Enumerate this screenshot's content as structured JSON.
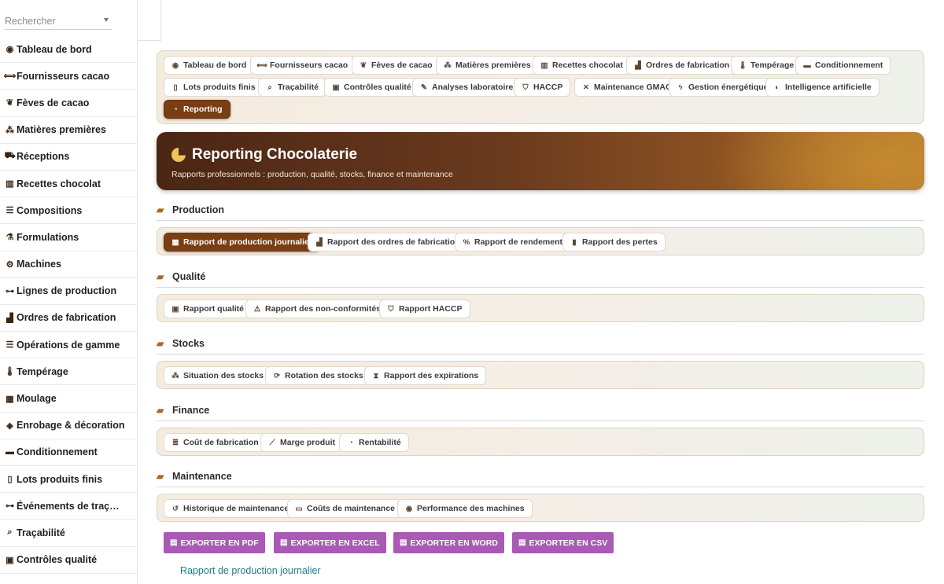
{
  "sidebar": {
    "search_placeholder": "Rechercher",
    "items": [
      {
        "label": "Tableau de bord",
        "icon": "gauge-icon",
        "glyph": "◉"
      },
      {
        "label": "Fournisseurs cacao",
        "icon": "handshake-icon",
        "glyph": "⟺"
      },
      {
        "label": "Fèves de cacao",
        "icon": "seedling-icon",
        "glyph": "❦"
      },
      {
        "label": "Matières premières",
        "icon": "cubes-icon",
        "glyph": "⁂"
      },
      {
        "label": "Réceptions",
        "icon": "truck-icon",
        "glyph": "⛟"
      },
      {
        "label": "Recettes chocolat",
        "icon": "book-icon",
        "glyph": "▥"
      },
      {
        "label": "Compositions",
        "icon": "list-icon",
        "glyph": "☰"
      },
      {
        "label": "Formulations",
        "icon": "flask-icon",
        "glyph": "⚗"
      },
      {
        "label": "Machines",
        "icon": "cogs-icon",
        "glyph": "⚙"
      },
      {
        "label": "Lignes de production",
        "icon": "sitemap-icon",
        "glyph": "⊶"
      },
      {
        "label": "Ordres de fabrication",
        "icon": "industry-icon",
        "glyph": "▟"
      },
      {
        "label": "Opérations de gamme",
        "icon": "list-ol-icon",
        "glyph": "☰"
      },
      {
        "label": "Tempérage",
        "icon": "thermometer-icon",
        "glyph": "🌡"
      },
      {
        "label": "Moulage",
        "icon": "grid-icon",
        "glyph": "▦"
      },
      {
        "label": "Enrobage & décoration",
        "icon": "fill-drip-icon",
        "glyph": "◈"
      },
      {
        "label": "Conditionnement",
        "icon": "box-icon",
        "glyph": "▬"
      },
      {
        "label": "Lots produits finis",
        "icon": "barcode-icon",
        "glyph": "▯"
      },
      {
        "label": "Événements de traç…",
        "icon": "project-diagram-icon",
        "glyph": "⊶"
      },
      {
        "label": "Traçabilité",
        "icon": "search-icon",
        "glyph": "⌕"
      },
      {
        "label": "Contrôles qualité",
        "icon": "clipboard-check-icon",
        "glyph": "▣"
      }
    ]
  },
  "nav": {
    "row1": [
      {
        "label": "Tableau de bord",
        "icon": "gauge-icon",
        "glyph": "◉"
      },
      {
        "label": "Fournisseurs cacao",
        "icon": "handshake-icon",
        "glyph": "⟺"
      },
      {
        "label": "Fèves de cacao",
        "icon": "seedling-icon",
        "glyph": "❦"
      },
      {
        "label": "Matières premières",
        "icon": "cubes-icon",
        "glyph": "⁂"
      },
      {
        "label": "Recettes chocolat",
        "icon": "book-icon",
        "glyph": "▥"
      },
      {
        "label": "Ordres de fabrication",
        "icon": "industry-icon",
        "glyph": "▟"
      },
      {
        "label": "Tempérage",
        "icon": "thermometer-icon",
        "glyph": "🌡"
      },
      {
        "label": "Conditionnement",
        "icon": "box-icon",
        "glyph": "▬"
      }
    ],
    "row2": [
      {
        "label": "Lots produits finis",
        "icon": "barcode-icon",
        "glyph": "▯"
      },
      {
        "label": "Traçabilité",
        "icon": "search-icon",
        "glyph": "⌕"
      },
      {
        "label": "Contrôles qualité",
        "icon": "clipboard-check-icon",
        "glyph": "▣"
      },
      {
        "label": "Analyses laboratoire",
        "icon": "pen-icon",
        "glyph": "✎"
      },
      {
        "label": "HACCP",
        "icon": "shield-icon",
        "glyph": "⛉"
      },
      {
        "label": "Maintenance GMAO",
        "icon": "tools-icon",
        "glyph": "✕"
      },
      {
        "label": "Gestion énergétique",
        "icon": "bolt-icon",
        "glyph": "ϟ"
      },
      {
        "label": "Intelligence artificielle",
        "icon": "brain-icon",
        "glyph": "◐"
      }
    ],
    "row3": [
      {
        "label": "Reporting",
        "icon": "chart-pie-icon",
        "glyph": "◔",
        "active": true
      }
    ]
  },
  "banner": {
    "title": "Reporting Chocolaterie",
    "subtitle": "Rapports professionnels : production, qualité, stocks, finance et maintenance",
    "icon": "chart-pie-icon"
  },
  "sections": [
    {
      "title": "Production",
      "icon": "folder-open-icon",
      "items": [
        {
          "label": "Rapport de production journalier",
          "icon": "calendar-day-icon",
          "glyph": "▦",
          "active": true
        },
        {
          "label": "Rapport des ordres de fabrication",
          "icon": "industry-icon",
          "glyph": "▟"
        },
        {
          "label": "Rapport de rendement",
          "icon": "percent-icon",
          "glyph": "%"
        },
        {
          "label": "Rapport des pertes",
          "icon": "trash-icon",
          "glyph": "▮"
        }
      ]
    },
    {
      "title": "Qualité",
      "icon": "folder-open-icon",
      "items": [
        {
          "label": "Rapport qualité",
          "icon": "clipboard-check-icon",
          "glyph": "▣"
        },
        {
          "label": "Rapport des non-conformités",
          "icon": "warning-icon",
          "glyph": "⚠"
        },
        {
          "label": "Rapport HACCP",
          "icon": "shield-icon",
          "glyph": "⛉"
        }
      ]
    },
    {
      "title": "Stocks",
      "icon": "folder-open-icon",
      "items": [
        {
          "label": "Situation des stocks",
          "icon": "cubes-icon",
          "glyph": "⁂"
        },
        {
          "label": "Rotation des stocks",
          "icon": "sync-icon",
          "glyph": "⟳"
        },
        {
          "label": "Rapport des expirations",
          "icon": "hourglass-icon",
          "glyph": "⧗"
        }
      ]
    },
    {
      "title": "Finance",
      "icon": "folder-open-icon",
      "items": [
        {
          "label": "Coût de fabrication",
          "icon": "coins-icon",
          "glyph": "≣"
        },
        {
          "label": "Marge produit",
          "icon": "chart-line-icon",
          "glyph": "⟋"
        },
        {
          "label": "Rentabilité",
          "icon": "chart-pie-icon",
          "glyph": "◔"
        }
      ]
    },
    {
      "title": "Maintenance",
      "icon": "folder-open-icon",
      "items": [
        {
          "label": "Historique de maintenance",
          "icon": "history-icon",
          "glyph": "↺"
        },
        {
          "label": "Coûts de maintenance",
          "icon": "money-bill-icon",
          "glyph": "▭"
        },
        {
          "label": "Performance des machines",
          "icon": "gauge-icon",
          "glyph": "◉"
        }
      ]
    }
  ],
  "exports": [
    {
      "label": "EXPORTER EN PDF",
      "icon": "file-icon"
    },
    {
      "label": "EXPORTER EN EXCEL",
      "icon": "file-icon"
    },
    {
      "label": "EXPORTER EN WORD",
      "icon": "file-icon"
    },
    {
      "label": "EXPORTER EN CSV",
      "icon": "file-icon"
    }
  ],
  "report_link": "Rapport de production journalier",
  "colors": {
    "accent": "#7a3e14",
    "export": "#a95ab5",
    "link": "#1a7f8a"
  }
}
